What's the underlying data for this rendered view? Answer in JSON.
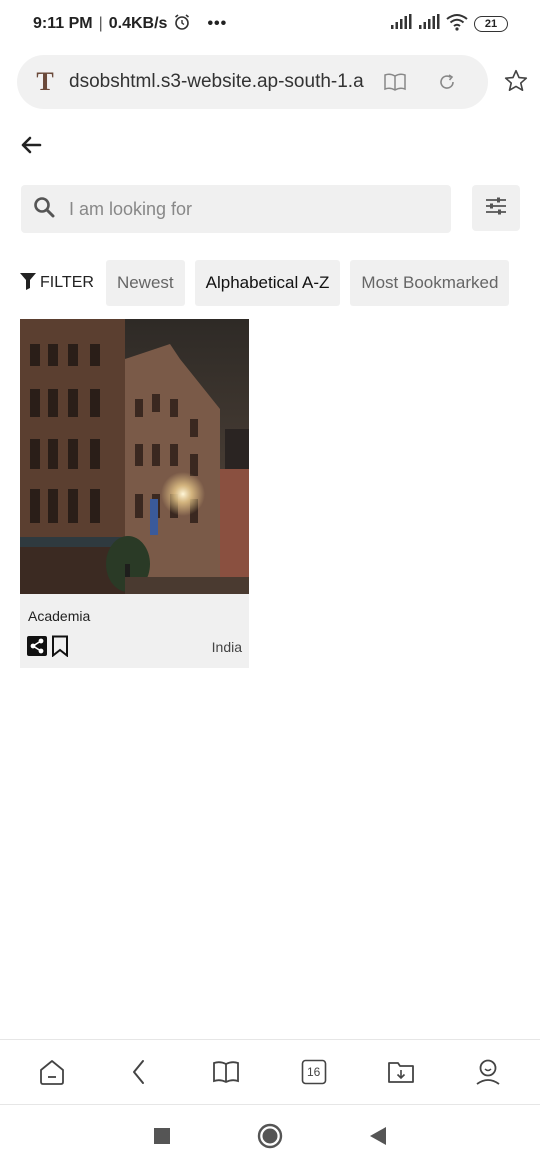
{
  "status_bar": {
    "time": "9:11 PM",
    "separator": "|",
    "speed": "0.4KB/s",
    "more": "•••",
    "battery": "21"
  },
  "address_bar": {
    "url": "dsobshtml.s3-website.ap-south-1.a",
    "logo_letter": "T"
  },
  "search": {
    "placeholder": "I am looking for",
    "value": ""
  },
  "filters": {
    "label": "FILTER",
    "chips": [
      {
        "label": "Newest",
        "active": false
      },
      {
        "label": "Alphabetical A-Z",
        "active": true
      },
      {
        "label": "Most Bookmarked",
        "active": false
      }
    ]
  },
  "cards": [
    {
      "title": "Academia",
      "location": "India",
      "image": "city-street-night-photo"
    }
  ],
  "browser_nav": {
    "tab_count": "16",
    "items": [
      "home-icon",
      "back-icon",
      "reader-icon",
      "tabs-icon",
      "downloads-icon",
      "profile-icon"
    ]
  },
  "system_nav": {
    "items": [
      "recents-square-icon",
      "home-circle-icon",
      "back-triangle-icon"
    ]
  },
  "colors": {
    "chip_bg": "#f0f0f0",
    "address_bg": "#f1f1f1",
    "text_dark": "#222222",
    "text_muted": "#888888"
  }
}
